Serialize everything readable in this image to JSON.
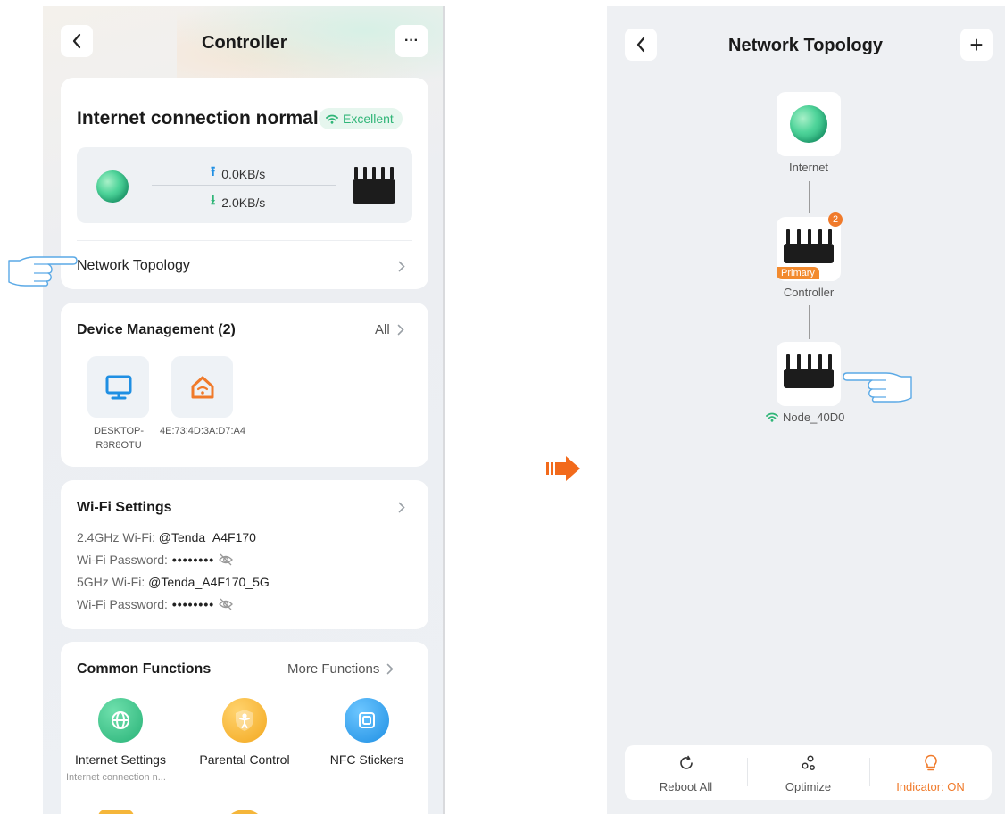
{
  "controller": {
    "title": "Controller",
    "back_icon": "chevron-left-icon",
    "more_icon": "more-dots-icon",
    "more_label": "···",
    "status": {
      "title": "Internet connection normal",
      "quality": "Excellent",
      "upload": "0.0KB/s",
      "download": "2.0KB/s"
    },
    "network_topology_label": "Network Topology",
    "device_management": {
      "title": "Device Management (2)",
      "all_label": "All",
      "devices": [
        {
          "name": "DESKTOP-R8R8OTU",
          "icon": "monitor-icon"
        },
        {
          "name": "4E:73:4D:3A:D7:A4",
          "icon": "smart-home-icon"
        }
      ]
    },
    "wifi": {
      "title": "Wi-Fi Settings",
      "lines": [
        {
          "label": "2.4GHz Wi-Fi:",
          "value": "@Tenda_A4F170"
        },
        {
          "label": "Wi-Fi Password:",
          "value": "••••••••"
        },
        {
          "label": "5GHz Wi-Fi:",
          "value": "@Tenda_A4F170_5G"
        },
        {
          "label": "Wi-Fi Password:",
          "value": "••••••••"
        }
      ]
    },
    "common_functions": {
      "title": "Common Functions",
      "more_label": "More Functions",
      "items": [
        {
          "label": "Internet Settings",
          "sub": "Internet connection n..."
        },
        {
          "label": "Parental Control",
          "sub": ""
        },
        {
          "label": "NFC Stickers",
          "sub": ""
        }
      ]
    }
  },
  "topology": {
    "title": "Network Topology",
    "add_label": "+",
    "nodes": [
      {
        "label": "Internet"
      },
      {
        "label": "Controller",
        "tag": "Primary",
        "count": "2"
      },
      {
        "label": "Node_40D0"
      }
    ],
    "bottom_bar": [
      {
        "label": "Reboot All",
        "icon": "refresh-icon"
      },
      {
        "label": "Optimize",
        "icon": "optimize-icon"
      },
      {
        "label": "Indicator: ON",
        "icon": "bulb-icon"
      }
    ]
  },
  "colors": {
    "accent_green": "#2fb577",
    "accent_blue": "#1f8fe3",
    "accent_orange": "#f07a2a"
  }
}
